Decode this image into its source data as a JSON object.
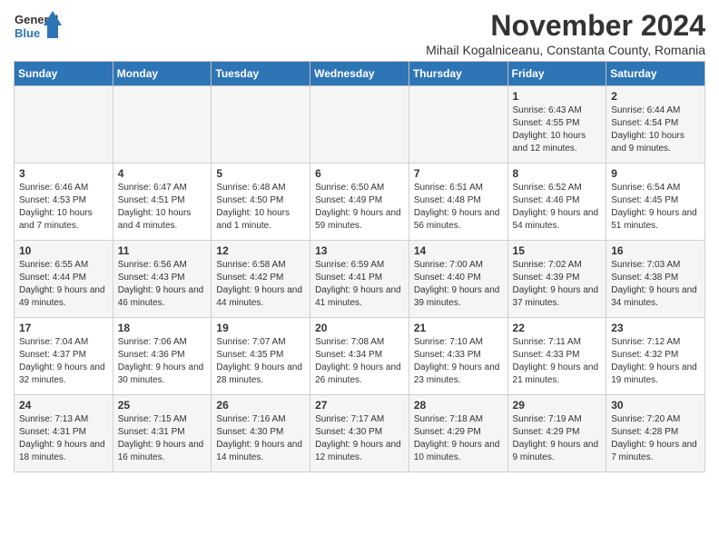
{
  "logo": {
    "line1": "General",
    "line2": "Blue"
  },
  "title": "November 2024",
  "subtitle": "Mihail Kogalniceanu, Constanta County, Romania",
  "days_header": [
    "Sunday",
    "Monday",
    "Tuesday",
    "Wednesday",
    "Thursday",
    "Friday",
    "Saturday"
  ],
  "weeks": [
    [
      {
        "day": "",
        "info": ""
      },
      {
        "day": "",
        "info": ""
      },
      {
        "day": "",
        "info": ""
      },
      {
        "day": "",
        "info": ""
      },
      {
        "day": "",
        "info": ""
      },
      {
        "day": "1",
        "info": "Sunrise: 6:43 AM\nSunset: 4:55 PM\nDaylight: 10 hours and 12 minutes."
      },
      {
        "day": "2",
        "info": "Sunrise: 6:44 AM\nSunset: 4:54 PM\nDaylight: 10 hours and 9 minutes."
      }
    ],
    [
      {
        "day": "3",
        "info": "Sunrise: 6:46 AM\nSunset: 4:53 PM\nDaylight: 10 hours and 7 minutes."
      },
      {
        "day": "4",
        "info": "Sunrise: 6:47 AM\nSunset: 4:51 PM\nDaylight: 10 hours and 4 minutes."
      },
      {
        "day": "5",
        "info": "Sunrise: 6:48 AM\nSunset: 4:50 PM\nDaylight: 10 hours and 1 minute."
      },
      {
        "day": "6",
        "info": "Sunrise: 6:50 AM\nSunset: 4:49 PM\nDaylight: 9 hours and 59 minutes."
      },
      {
        "day": "7",
        "info": "Sunrise: 6:51 AM\nSunset: 4:48 PM\nDaylight: 9 hours and 56 minutes."
      },
      {
        "day": "8",
        "info": "Sunrise: 6:52 AM\nSunset: 4:46 PM\nDaylight: 9 hours and 54 minutes."
      },
      {
        "day": "9",
        "info": "Sunrise: 6:54 AM\nSunset: 4:45 PM\nDaylight: 9 hours and 51 minutes."
      }
    ],
    [
      {
        "day": "10",
        "info": "Sunrise: 6:55 AM\nSunset: 4:44 PM\nDaylight: 9 hours and 49 minutes."
      },
      {
        "day": "11",
        "info": "Sunrise: 6:56 AM\nSunset: 4:43 PM\nDaylight: 9 hours and 46 minutes."
      },
      {
        "day": "12",
        "info": "Sunrise: 6:58 AM\nSunset: 4:42 PM\nDaylight: 9 hours and 44 minutes."
      },
      {
        "day": "13",
        "info": "Sunrise: 6:59 AM\nSunset: 4:41 PM\nDaylight: 9 hours and 41 minutes."
      },
      {
        "day": "14",
        "info": "Sunrise: 7:00 AM\nSunset: 4:40 PM\nDaylight: 9 hours and 39 minutes."
      },
      {
        "day": "15",
        "info": "Sunrise: 7:02 AM\nSunset: 4:39 PM\nDaylight: 9 hours and 37 minutes."
      },
      {
        "day": "16",
        "info": "Sunrise: 7:03 AM\nSunset: 4:38 PM\nDaylight: 9 hours and 34 minutes."
      }
    ],
    [
      {
        "day": "17",
        "info": "Sunrise: 7:04 AM\nSunset: 4:37 PM\nDaylight: 9 hours and 32 minutes."
      },
      {
        "day": "18",
        "info": "Sunrise: 7:06 AM\nSunset: 4:36 PM\nDaylight: 9 hours and 30 minutes."
      },
      {
        "day": "19",
        "info": "Sunrise: 7:07 AM\nSunset: 4:35 PM\nDaylight: 9 hours and 28 minutes."
      },
      {
        "day": "20",
        "info": "Sunrise: 7:08 AM\nSunset: 4:34 PM\nDaylight: 9 hours and 26 minutes."
      },
      {
        "day": "21",
        "info": "Sunrise: 7:10 AM\nSunset: 4:33 PM\nDaylight: 9 hours and 23 minutes."
      },
      {
        "day": "22",
        "info": "Sunrise: 7:11 AM\nSunset: 4:33 PM\nDaylight: 9 hours and 21 minutes."
      },
      {
        "day": "23",
        "info": "Sunrise: 7:12 AM\nSunset: 4:32 PM\nDaylight: 9 hours and 19 minutes."
      }
    ],
    [
      {
        "day": "24",
        "info": "Sunrise: 7:13 AM\nSunset: 4:31 PM\nDaylight: 9 hours and 18 minutes."
      },
      {
        "day": "25",
        "info": "Sunrise: 7:15 AM\nSunset: 4:31 PM\nDaylight: 9 hours and 16 minutes."
      },
      {
        "day": "26",
        "info": "Sunrise: 7:16 AM\nSunset: 4:30 PM\nDaylight: 9 hours and 14 minutes."
      },
      {
        "day": "27",
        "info": "Sunrise: 7:17 AM\nSunset: 4:30 PM\nDaylight: 9 hours and 12 minutes."
      },
      {
        "day": "28",
        "info": "Sunrise: 7:18 AM\nSunset: 4:29 PM\nDaylight: 9 hours and 10 minutes."
      },
      {
        "day": "29",
        "info": "Sunrise: 7:19 AM\nSunset: 4:29 PM\nDaylight: 9 hours and 9 minutes."
      },
      {
        "day": "30",
        "info": "Sunrise: 7:20 AM\nSunset: 4:28 PM\nDaylight: 9 hours and 7 minutes."
      }
    ]
  ]
}
